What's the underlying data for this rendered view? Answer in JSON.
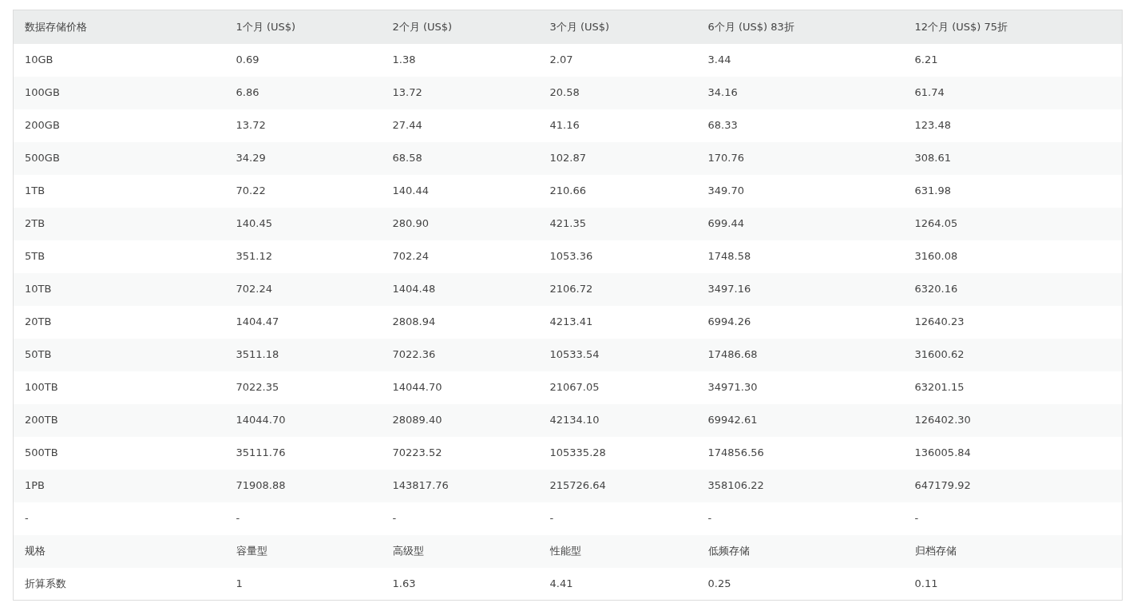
{
  "table": {
    "columns": [
      "数据存储价格",
      "1个月 (US$)",
      "2个月 (US$)",
      "3个月 (US$)",
      "6个月 (US$) 83折",
      "12个月 (US$) 75折"
    ],
    "rows": [
      [
        "10GB",
        "0.69",
        "1.38",
        "2.07",
        "3.44",
        "6.21"
      ],
      [
        "100GB",
        "6.86",
        "13.72",
        "20.58",
        "34.16",
        "61.74"
      ],
      [
        "200GB",
        "13.72",
        "27.44",
        "41.16",
        "68.33",
        "123.48"
      ],
      [
        "500GB",
        "34.29",
        "68.58",
        "102.87",
        "170.76",
        "308.61"
      ],
      [
        "1TB",
        "70.22",
        "140.44",
        "210.66",
        "349.70",
        "631.98"
      ],
      [
        "2TB",
        "140.45",
        "280.90",
        "421.35",
        "699.44",
        "1264.05"
      ],
      [
        "5TB",
        "351.12",
        "702.24",
        "1053.36",
        "1748.58",
        "3160.08"
      ],
      [
        "10TB",
        "702.24",
        "1404.48",
        "2106.72",
        "3497.16",
        "6320.16"
      ],
      [
        "20TB",
        "1404.47",
        "2808.94",
        "4213.41",
        "6994.26",
        "12640.23"
      ],
      [
        "50TB",
        "3511.18",
        "7022.36",
        "10533.54",
        "17486.68",
        "31600.62"
      ],
      [
        "100TB",
        "7022.35",
        "14044.70",
        "21067.05",
        "34971.30",
        "63201.15"
      ],
      [
        "200TB",
        "14044.70",
        "28089.40",
        "42134.10",
        "69942.61",
        "126402.30"
      ],
      [
        "500TB",
        "35111.76",
        "70223.52",
        "105335.28",
        "174856.56",
        "136005.84"
      ],
      [
        "1PB",
        "71908.88",
        "143817.76",
        "215726.64",
        "358106.22",
        "647179.92"
      ],
      [
        "-",
        "-",
        "-",
        "-",
        "-",
        "-"
      ],
      [
        "规格",
        "容量型",
        "高级型",
        "性能型",
        "低频存储",
        "归档存储"
      ],
      [
        "折算系数",
        "1",
        "1.63",
        "4.41",
        "0.25",
        "0.11"
      ]
    ]
  }
}
